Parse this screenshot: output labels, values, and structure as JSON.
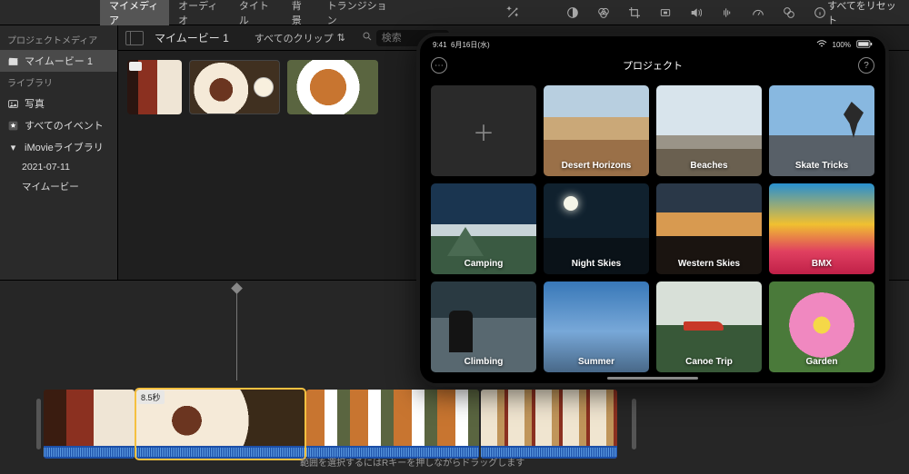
{
  "topbar": {
    "tabs": [
      "マイメディア",
      "オーディオ",
      "タイトル",
      "背景",
      "トランジション"
    ],
    "active_tab": 0,
    "reset": "すべてをリセット"
  },
  "sidebar": {
    "header1": "プロジェクトメディア",
    "project": "マイムービー 1",
    "header2": "ライブラリ",
    "items": [
      {
        "icon": "photo",
        "label": "写真"
      },
      {
        "icon": "star",
        "label": "すべてのイベント"
      }
    ],
    "library_name": "iMovieライブラリ",
    "events": [
      "2021-07-11",
      "マイムービー"
    ]
  },
  "browser": {
    "title": "マイムービー 1",
    "filter": "すべてのクリップ",
    "search_placeholder": "検索"
  },
  "timeline": {
    "selected_duration": "8.5秒",
    "hint": "範囲を選択するにはRキーを押しながらドラッグします"
  },
  "ipad": {
    "time": "9:41",
    "date": "6月16日(水)",
    "wifi": "100%",
    "header_title": "プロジェクト",
    "projects": [
      {
        "label": "",
        "cls": "new",
        "is_new": true
      },
      {
        "label": "Desert Horizons",
        "cls": "p-dh"
      },
      {
        "label": "Beaches",
        "cls": "p-bc"
      },
      {
        "label": "Skate Tricks",
        "cls": "p-st"
      },
      {
        "label": "Camping",
        "cls": "p-cp"
      },
      {
        "label": "Night Skies",
        "cls": "p-ns"
      },
      {
        "label": "Western Skies",
        "cls": "p-ws"
      },
      {
        "label": "BMX",
        "cls": "p-bx"
      },
      {
        "label": "Climbing",
        "cls": "p-cl"
      },
      {
        "label": "Summer",
        "cls": "p-sm"
      },
      {
        "label": "Canoe Trip",
        "cls": "p-ct"
      },
      {
        "label": "Garden",
        "cls": "p-gd"
      }
    ]
  }
}
